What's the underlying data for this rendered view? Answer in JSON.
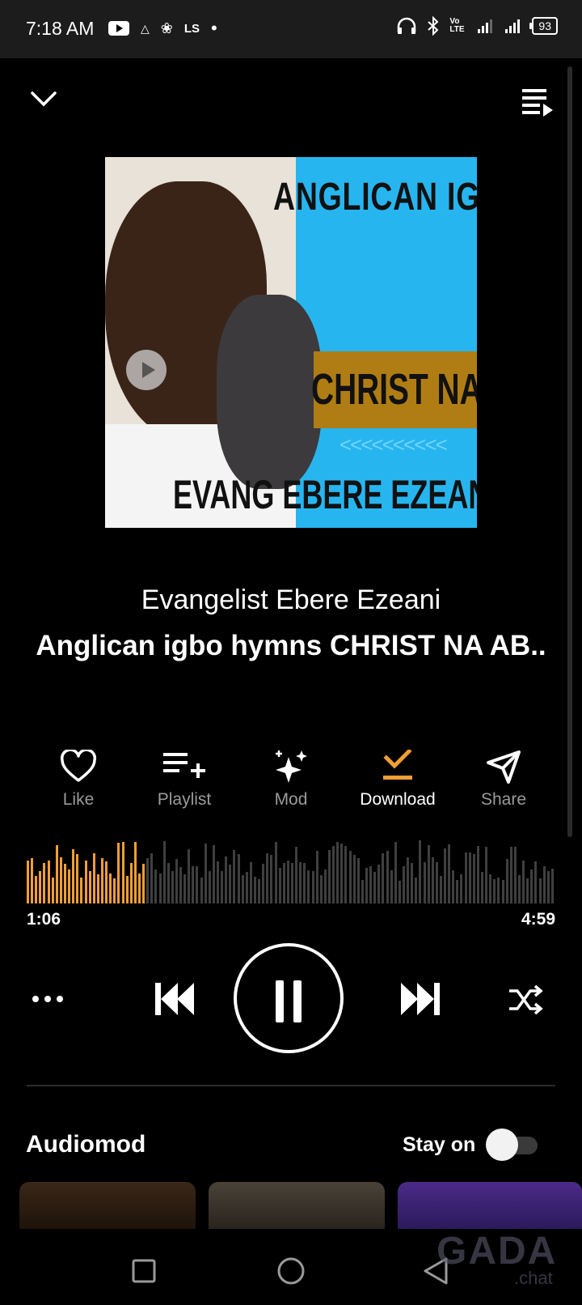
{
  "status_bar": {
    "time": "7:18 AM",
    "left_icons": [
      "youtube-icon",
      "warning-icon",
      "club-badge-icon",
      "ls-icon",
      "dot-icon"
    ],
    "ls_text": "LS",
    "volte_text": "Vo LTE",
    "battery": "93"
  },
  "cover": {
    "line1": "ANGLICAN IGB",
    "line2": "CHRIST NA",
    "line3": "EVANG EBERE EZEANI",
    "chevrons": "<<<<<<<<<<"
  },
  "track": {
    "artist": "Evangelist Ebere Ezeani",
    "title": "Anglican igbo hymns CHRIST NA AB.."
  },
  "actions": {
    "like": "Like",
    "playlist": "Playlist",
    "mod": "Mod",
    "download": "Download",
    "share": "Share"
  },
  "progress": {
    "current": "1:06",
    "total": "4:59",
    "played_fraction": 0.22
  },
  "audiomod": {
    "title": "Audiomod",
    "stay_on": "Stay on",
    "stay_on_enabled": false
  },
  "watermark": {
    "brand": "GADA",
    "domain": ".chat"
  },
  "colors": {
    "accent": "#f09e34",
    "background": "#000000",
    "inactive_label": "#9a9a9a"
  }
}
